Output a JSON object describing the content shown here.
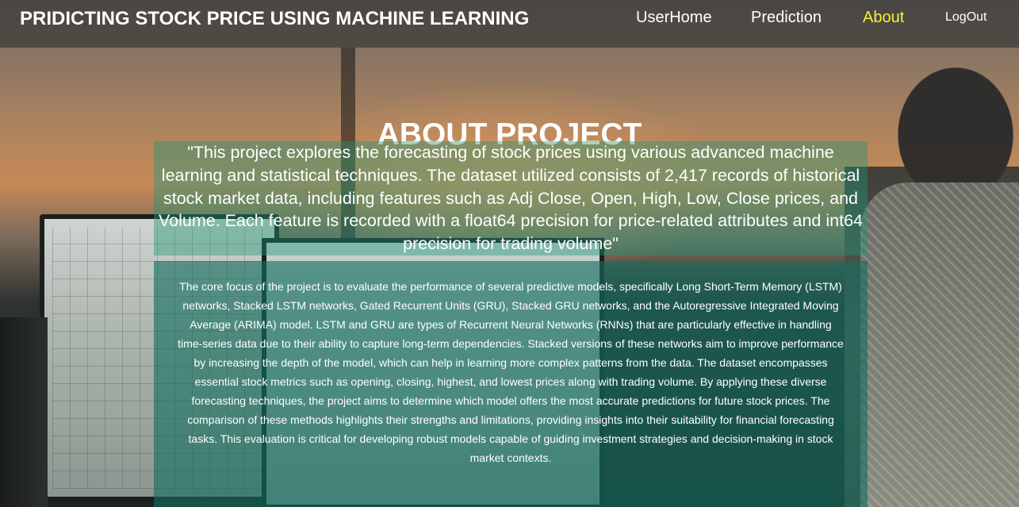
{
  "navbar": {
    "brand": "PRIDICTING STOCK PRICE USING MACHINE LEARNING",
    "links": [
      {
        "label": "UserHome"
      },
      {
        "label": "Prediction"
      },
      {
        "label": "About",
        "active": true
      },
      {
        "label": "LogOut"
      }
    ],
    "active_color": "#f5f03a"
  },
  "main": {
    "title": "ABOUT PROJECT",
    "quote": "\"This project explores the forecasting of stock prices using various advanced machine learning and statistical techniques. The dataset utilized consists of 2,417 records of historical stock market data, including features such as Adj Close, Open, High, Low, Close prices, and Volume. Each feature is recorded with a float64 precision for price-related attributes and int64 precision for trading volume\"",
    "description": "The core focus of the project is to evaluate the performance of several predictive models, specifically Long Short-Term Memory (LSTM) networks, Stacked LSTM networks, Gated Recurrent Units (GRU), Stacked GRU networks, and the Autoregressive Integrated Moving Average (ARIMA) model. LSTM and GRU are types of Recurrent Neural Networks (RNNs) that are particularly effective in handling time-series data due to their ability to capture long-term dependencies. Stacked versions of these networks aim to improve performance by increasing the depth of the model, which can help in learning more complex patterns from the data. The dataset encompasses essential stock metrics such as opening, closing, highest, and lowest prices along with trading volume. By applying these diverse forecasting techniques, the project aims to determine which model offers the most accurate predictions for future stock prices. The comparison of these methods highlights their strengths and limitations, providing insights into their suitability for financial forecasting tasks. This evaluation is critical for developing robust models capable of guiding investment strategies and decision-making in stock market contexts."
  }
}
